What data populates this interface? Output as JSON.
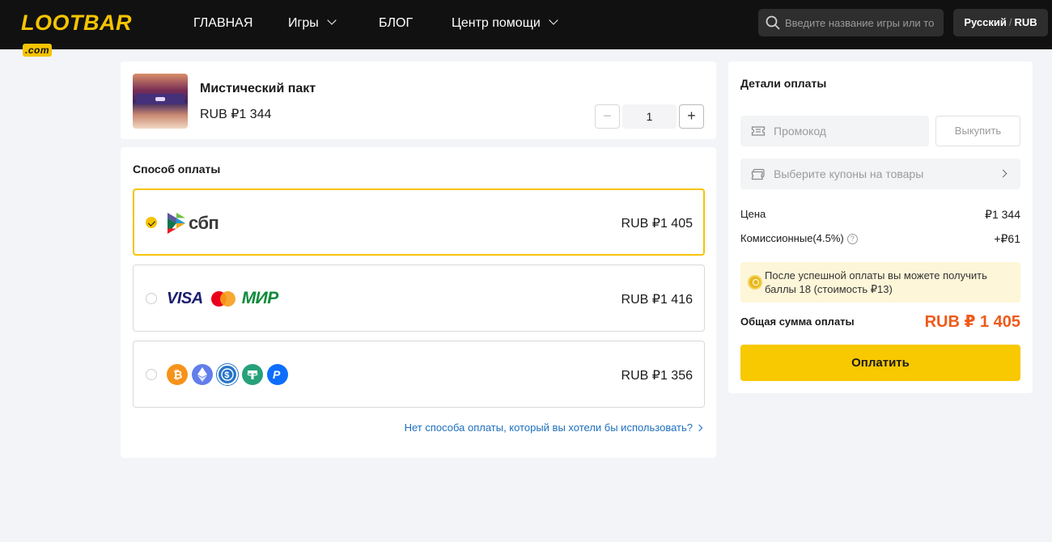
{
  "header": {
    "logo_text": "LOOTBAR",
    "logo_suffix": ".com",
    "nav": [
      {
        "label": "ГЛАВНАЯ"
      },
      {
        "label": "Игры"
      },
      {
        "label": "БЛОГ"
      },
      {
        "label": "Центр помощи"
      }
    ],
    "search_placeholder": "Введите название игры или то",
    "language": "Русский",
    "currency": "RUB"
  },
  "product": {
    "name": "Мистический пакт",
    "price": "RUB ₽1 344",
    "quantity": "1",
    "minus": "−",
    "plus": "+"
  },
  "payment": {
    "title": "Способ оплаты",
    "methods": [
      {
        "name": "sbp",
        "logo_text": "сбп",
        "price": "RUB ₽1 405",
        "selected": true
      },
      {
        "name": "cards",
        "logos": [
          "VISA",
          "Mastercard",
          "МИР"
        ],
        "visa": "VISA",
        "mir": "МИР",
        "price": "RUB ₽1 416",
        "selected": false
      },
      {
        "name": "crypto",
        "logos": [
          "bitcoin-icon",
          "ethereum-icon",
          "usdc-icon",
          "tether-icon",
          "paypal-icon"
        ],
        "price": "RUB ₽1 356",
        "selected": false
      }
    ],
    "other_link": "Нет способа оплаты, который вы хотели бы использовать?"
  },
  "details": {
    "title": "Детали оплаты",
    "promo_placeholder": "Промокод",
    "redeem_label": "Выкупить",
    "coupon_label": "Выберите купоны на товары",
    "price_label": "Цена",
    "price_value": "₽1 344",
    "fee_label": "Комиссионные(4.5%)",
    "fee_value": "+₽61",
    "bonus_text": "После успешной оплаты вы можете получить баллы 18 (стоимость ₽13)",
    "total_label": "Общая сумма оплаты",
    "total_value": "RUB ₽ 1 405",
    "pay_label": "Оплатить"
  },
  "colors": {
    "accent": "#f8c800",
    "header_bg": "#111111",
    "total": "#ef5a1a",
    "link": "#1d6fbf"
  }
}
